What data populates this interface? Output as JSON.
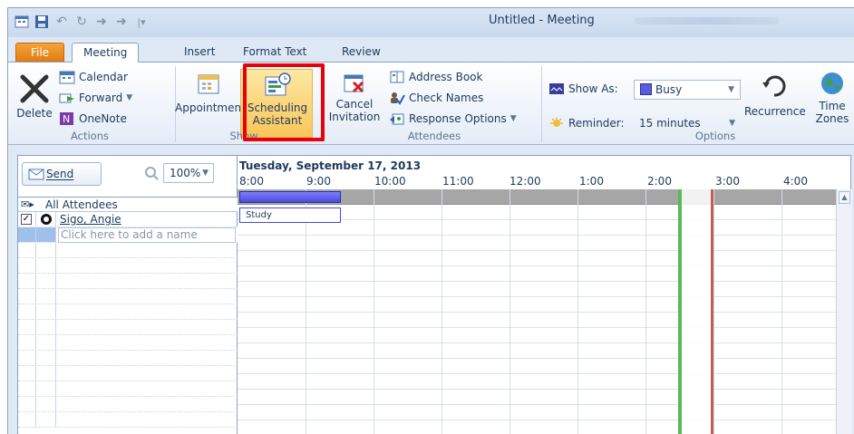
{
  "window": {
    "title": "Untitled - Meeting"
  },
  "tabs": [
    {
      "label": "File"
    },
    {
      "label": "Meeting"
    },
    {
      "label": "Insert"
    },
    {
      "label": "Format Text"
    },
    {
      "label": "Review"
    }
  ],
  "ribbon": {
    "actions": {
      "delete": "Delete",
      "calendar": "Calendar",
      "forward": "Forward",
      "onenote": "OneNote",
      "label": "Actions"
    },
    "show": {
      "appointment": "Appointment",
      "scheduling_line1": "Scheduling",
      "scheduling_line2": "Assistant",
      "label": "Show"
    },
    "attendees": {
      "cancel_line1": "Cancel",
      "cancel_line2": "Invitation",
      "address_book": "Address Book",
      "check_names": "Check Names",
      "response_options": "Response Options",
      "label": "Attendees"
    },
    "options": {
      "show_as_label": "Show As:",
      "show_as_value": "Busy",
      "reminder_label": "Reminder:",
      "reminder_value": "15 minutes",
      "recurrence": "Recurrence",
      "time_line1": "Time",
      "time_line2": "Zones",
      "label": "Options"
    }
  },
  "scheduler": {
    "send_label": "Send",
    "zoom": "100%",
    "date": "Tuesday, September 17, 2013",
    "hours": [
      "8:00",
      "9:00",
      "10:00",
      "11:00",
      "12:00",
      "1:00",
      "2:00",
      "3:00",
      "4:00"
    ],
    "all_attendees": "All Attendees",
    "attendee_name": "Sigo, Angie",
    "add_name_placeholder": "Click here to add a name",
    "appointment_label": "Study"
  },
  "colors": {
    "busy": "#4b4bd8",
    "highlight": "#e8000b",
    "meeting_start": "#5bb85b",
    "meeting_end": "#c85a5a",
    "file_tab": "#e0780e"
  }
}
